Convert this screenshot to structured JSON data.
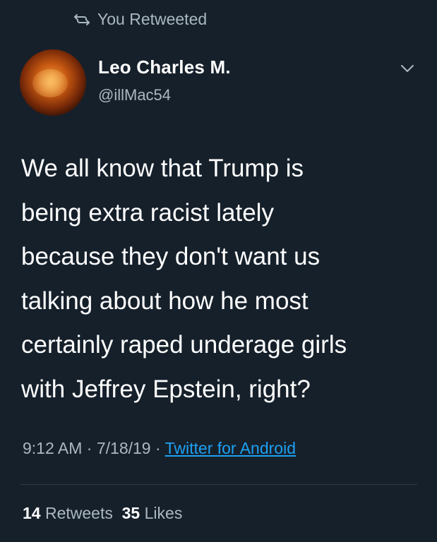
{
  "retweet_header": {
    "icon": "retweet-icon",
    "label": "You Retweeted"
  },
  "author": {
    "display_name": "Leo Charles M.",
    "handle": "@illMac54",
    "avatar": "dragon-avatar"
  },
  "tweet": {
    "text": "We all know that Trump is\nbeing extra racist lately\nbecause they don't want us\ntalking about how he most\ncertainly raped underage girls\nwith Jeffrey Epstein, right?"
  },
  "meta": {
    "time": "9:12 AM",
    "separator": " · ",
    "date": "7/18/19",
    "source": "Twitter for Android"
  },
  "stats": {
    "retweets_count": "14",
    "retweets_label": "Retweets",
    "likes_count": "35",
    "likes_label": "Likes"
  },
  "colors": {
    "background": "#16202b",
    "text": "#ffffff",
    "secondary_text": "#aab8c2",
    "link": "#1da1f2"
  }
}
